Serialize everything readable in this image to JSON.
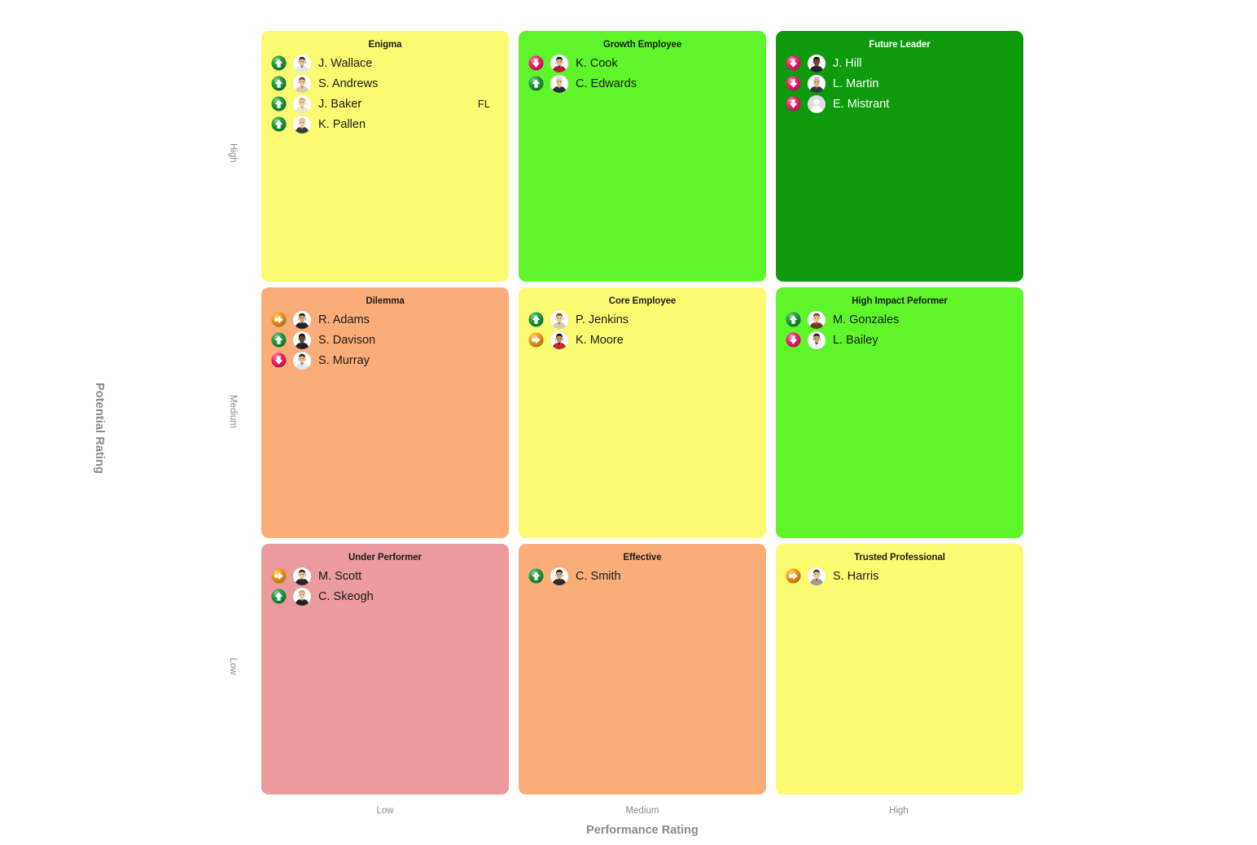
{
  "axes": {
    "y_title": "Potential Rating",
    "y_ticks": [
      "High",
      "Medium",
      "Low"
    ],
    "x_title": "Performance Rating",
    "x_ticks": [
      "Low",
      "Medium",
      "High"
    ]
  },
  "colors": {
    "pale_yellow": "#FBFB72",
    "bright_green": "#5FF52B",
    "dark_green": "#0D9A0D",
    "orange": "#FBAD79",
    "salmon_pink": "#EB9A9E",
    "trend_up": "#1E9E3C",
    "trend_down": "#F3236E",
    "trend_flat": "#F59B18",
    "title_grey": "#8A8A8A",
    "text_dark": "#1C1C1C",
    "text_light": "#FFFFFF"
  },
  "cells": [
    {
      "id": "enigma",
      "title": "Enigma",
      "fill": "#FBFB72",
      "text_style": "dark",
      "employees": [
        {
          "name": "J. Wallace",
          "trend": "arrow-up-icon",
          "avatar": "man-tie-blue",
          "tag": ""
        },
        {
          "name": "S. Andrews",
          "trend": "arrow-up-icon",
          "avatar": "woman-brown-bob",
          "tag": ""
        },
        {
          "name": "J. Baker",
          "trend": "arrow-up-icon",
          "avatar": "woman-blonde",
          "tag": "FL"
        },
        {
          "name": "K. Pallen",
          "trend": "arrow-up-icon",
          "avatar": "woman-blonde-2",
          "tag": ""
        }
      ]
    },
    {
      "id": "growth-employee",
      "title": "Growth Employee",
      "fill": "#5FF52B",
      "text_style": "dark",
      "employees": [
        {
          "name": "K. Cook",
          "trend": "arrow-down-icon",
          "avatar": "woman-dark-hair",
          "tag": ""
        },
        {
          "name": "C. Edwards",
          "trend": "arrow-up-icon",
          "avatar": "man-silver",
          "tag": ""
        }
      ]
    },
    {
      "id": "future-leader",
      "title": "Future Leader",
      "fill": "#0D9A0D",
      "text_style": "light",
      "employees": [
        {
          "name": "J. Hill",
          "trend": "arrow-down-icon",
          "avatar": "man-dark-skin",
          "tag": ""
        },
        {
          "name": "L. Martin",
          "trend": "arrow-down-icon",
          "avatar": "man-grey-hair",
          "tag": ""
        },
        {
          "name": "E. Mistrant",
          "trend": "arrow-down-icon",
          "avatar": "placeholder",
          "tag": ""
        }
      ]
    },
    {
      "id": "dilemma",
      "title": "Dilemma",
      "fill": "#FBAD79",
      "text_style": "dark",
      "employees": [
        {
          "name": "R. Adams",
          "trend": "arrow-right-icon",
          "avatar": "woman-dark-suit",
          "tag": ""
        },
        {
          "name": "S. Davison",
          "trend": "arrow-up-icon",
          "avatar": "man-dark-skin",
          "tag": ""
        },
        {
          "name": "S. Murray",
          "trend": "arrow-down-icon",
          "avatar": "man-tie-blue",
          "tag": ""
        }
      ]
    },
    {
      "id": "core-employee",
      "title": "Core Employee",
      "fill": "#FBFB72",
      "text_style": "dark",
      "employees": [
        {
          "name": "P. Jenkins",
          "trend": "arrow-up-icon",
          "avatar": "woman-brown-bob",
          "tag": ""
        },
        {
          "name": "K. Moore",
          "trend": "arrow-right-icon",
          "avatar": "woman-red-top",
          "tag": ""
        }
      ]
    },
    {
      "id": "high-impact-performer",
      "title": "High Impact Peformer",
      "fill": "#5FF52B",
      "text_style": "dark",
      "employees": [
        {
          "name": "M. Gonzales",
          "trend": "arrow-up-icon",
          "avatar": "woman-auburn",
          "tag": ""
        },
        {
          "name": "L. Bailey",
          "trend": "arrow-down-icon",
          "avatar": "woman-white-top",
          "tag": ""
        }
      ]
    },
    {
      "id": "under-performer",
      "title": "Under Performer",
      "fill": "#EB9A9E",
      "text_style": "dark",
      "employees": [
        {
          "name": "M. Scott",
          "trend": "arrow-right-icon",
          "avatar": "man-young-dark",
          "tag": ""
        },
        {
          "name": "C. Skeogh",
          "trend": "arrow-up-icon",
          "avatar": "man-blond",
          "tag": ""
        }
      ]
    },
    {
      "id": "effective",
      "title": "Effective",
      "fill": "#FBAD79",
      "text_style": "dark",
      "employees": [
        {
          "name": "C. Smith",
          "trend": "arrow-up-icon",
          "avatar": "woman-short-dark",
          "tag": ""
        }
      ]
    },
    {
      "id": "trusted-professional",
      "title": "Trusted Professional",
      "fill": "#FBFB72",
      "text_style": "dark",
      "employees": [
        {
          "name": "S. Harris",
          "trend": "arrow-right-icon",
          "avatar": "man-grey-jacket",
          "tag": ""
        }
      ]
    }
  ]
}
